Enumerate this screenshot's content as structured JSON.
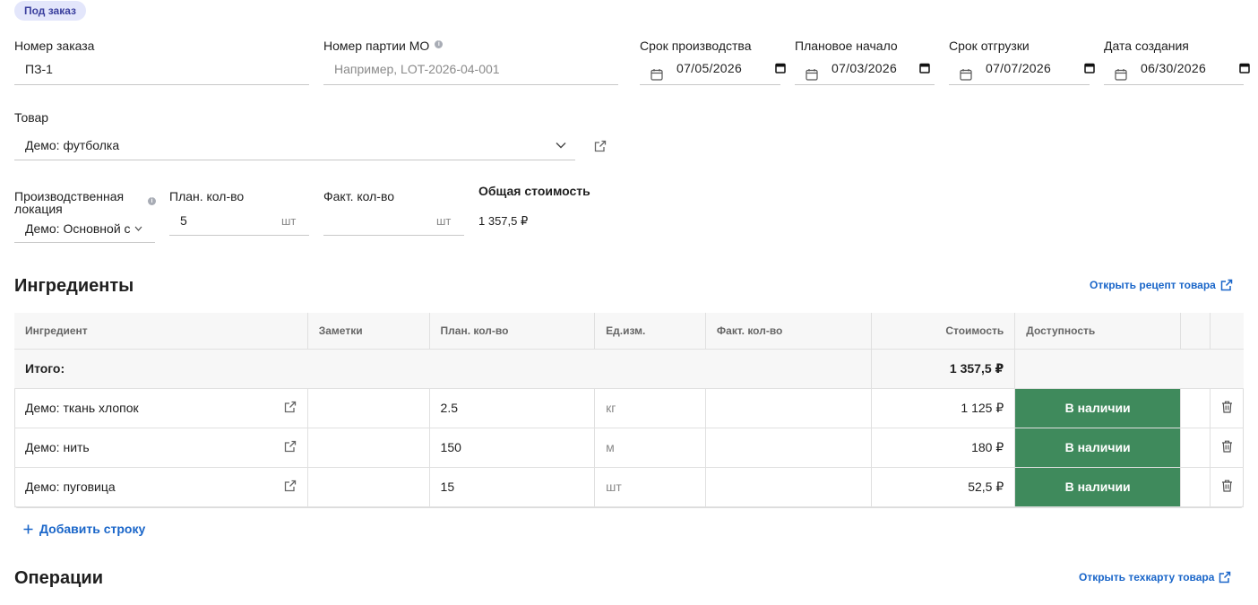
{
  "badge": "Под заказ",
  "fields": {
    "order_number": {
      "label": "Номер заказа",
      "value": "ПЗ-1"
    },
    "batch_number": {
      "label": "Номер партии МО",
      "placeholder": "Например, LOT-2026-04-001"
    },
    "production_deadline": {
      "label": "Срок производства",
      "value": "07/05/2026"
    },
    "planned_start": {
      "label": "Плановое начало",
      "value": "07/03/2026"
    },
    "shipping_deadline": {
      "label": "Срок отгрузки",
      "value": "07/07/2026"
    },
    "created_date": {
      "label": "Дата создания",
      "value": "06/30/2026"
    },
    "product": {
      "label": "Товар",
      "value": "Демо: футболка"
    },
    "location": {
      "label_line1": "Производственная",
      "label_line2": "локация",
      "value": "Демо: Основной с"
    },
    "planned_qty": {
      "label": "План. кол-во",
      "value": "5",
      "unit": "шт"
    },
    "actual_qty": {
      "label": "Факт. кол-во",
      "value": "",
      "unit": "шт"
    },
    "total_cost": {
      "label": "Общая стоимость",
      "value": "1 357,5 ₽"
    }
  },
  "ingredients": {
    "title": "Ингредиенты",
    "open_recipe_link": "Открыть рецепт товара",
    "columns": [
      "Ингредиент",
      "Заметки",
      "План. кол-во",
      "Ед.изм.",
      "Факт. кол-во",
      "Стоимость",
      "Доступность"
    ],
    "total_label": "Итого:",
    "total_value": "1 357,5 ₽",
    "rows": [
      {
        "name": "Демо: ткань хлопок",
        "notes": "",
        "planned": "2.5",
        "unit": "кг",
        "actual": "",
        "cost": "1 125 ₽",
        "availability": "В наличии"
      },
      {
        "name": "Демо: нить",
        "notes": "",
        "planned": "150",
        "unit": "м",
        "actual": "",
        "cost": "180 ₽",
        "availability": "В наличии"
      },
      {
        "name": "Демо: пуговица",
        "notes": "",
        "planned": "15",
        "unit": "шт",
        "actual": "",
        "cost": "52,5 ₽",
        "availability": "В наличии"
      }
    ],
    "add_row": "Добавить строку"
  },
  "operations": {
    "title": "Операции",
    "open_routing_link": "Открыть техкарту товара"
  },
  "colors": {
    "accent": "#1a66c9",
    "available": "#3f8a5c",
    "badge_bg": "#e3e6fb"
  }
}
